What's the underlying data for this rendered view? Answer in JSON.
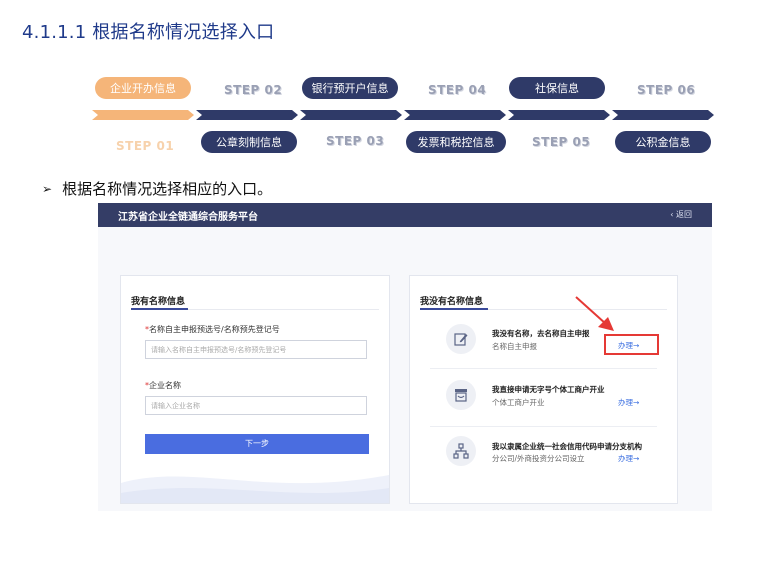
{
  "section_title": "4.1.1.1 根据名称情况选择入口",
  "steps": {
    "top_row": [
      {
        "label": "企业开办信息",
        "style": "orange"
      },
      {
        "label": "STEP 02",
        "style": "text"
      },
      {
        "label": "银行预开户信息",
        "style": "navy"
      },
      {
        "label": "STEP 04",
        "style": "text"
      },
      {
        "label": "社保信息",
        "style": "navy"
      },
      {
        "label": "STEP 06",
        "style": "text"
      }
    ],
    "bottom_row": [
      {
        "label": "STEP 01",
        "style": "faded"
      },
      {
        "label": "公章刻制信息",
        "style": "navy"
      },
      {
        "label": "STEP 03",
        "style": "text"
      },
      {
        "label": "发票和税控信息",
        "style": "navy"
      },
      {
        "label": "STEP 05",
        "style": "text"
      },
      {
        "label": "公积金信息",
        "style": "navy"
      }
    ]
  },
  "bullet": {
    "marker": "➢",
    "text": "根据名称情况选择相应的入口。"
  },
  "screenshot": {
    "header_title": "江苏省企业全链通综合服务平台",
    "back_label": "‹ 返回",
    "left_card": {
      "heading": "我有名称信息",
      "field1_label": "名称自主申报预选号/名称预先登记号",
      "field1_placeholder": "请输入名称自主申报预选号/名称预先登记号",
      "field2_label": "企业名称",
      "field2_placeholder": "请输入企业名称",
      "required_mark": "*",
      "next_button": "下一步"
    },
    "right_card": {
      "heading": "我没有名称信息",
      "options": [
        {
          "title": "我没有名称，去名称自主申报",
          "subtitle": "名称自主申报",
          "action": "办理→",
          "icon": "edit-icon"
        },
        {
          "title": "我直接申请无字号个体工商户开业",
          "subtitle": "个体工商户开业",
          "action": "办理→",
          "icon": "store-icon"
        },
        {
          "title": "我以隶属企业统一社会信用代码申请分支机构",
          "subtitle": "分公司/外商投资分公司设立",
          "action": "办理→",
          "icon": "org-chart-icon"
        }
      ]
    },
    "colors": {
      "header": "#343d66",
      "accent_blue": "#4a6de0",
      "highlight_red": "#e53935",
      "step_orange": "#f5b579",
      "step_navy": "#2f3a68"
    }
  }
}
